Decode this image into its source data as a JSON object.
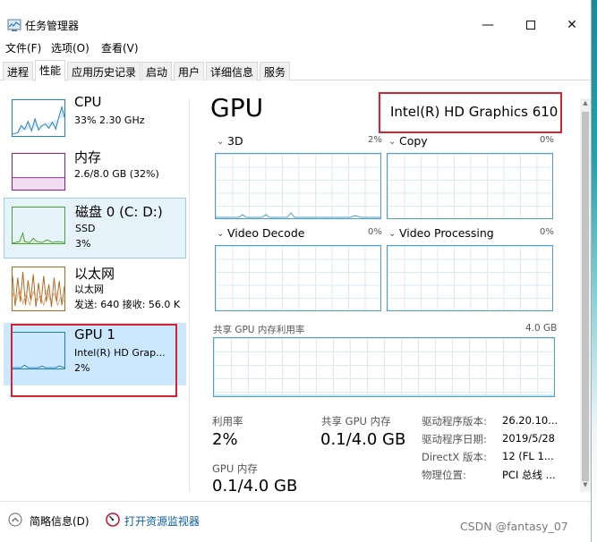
{
  "window": {
    "title": "任务管理器"
  },
  "menu": [
    "文件(F)",
    "选项(O)",
    "查看(V)"
  ],
  "tabs": [
    "进程",
    "性能",
    "应用历史记录",
    "启动",
    "用户",
    "详细信息",
    "服务"
  ],
  "resources": {
    "cpu": {
      "name": "CPU",
      "sub1": "33% 2.30 GHz",
      "color": "#1d7ec7"
    },
    "memory": {
      "name": "内存",
      "sub1": "2.6/8.0 GB (32%)",
      "color": "#8b1a8b"
    },
    "disk": {
      "name": "磁盘 0 (C: D:)",
      "sub1": "SSD",
      "sub2": "3%",
      "color": "#4aa02c"
    },
    "ethernet": {
      "name": "以太网",
      "sub1": "以太网",
      "sub2": "发送: 640 接收: 56.0 K",
      "color": "#b5651d"
    },
    "gpu": {
      "name": "GPU 1",
      "sub1": "Intel(R) HD Grap...",
      "sub2": "2%",
      "color": "#1d7ec7"
    }
  },
  "gpu": {
    "title": "GPU",
    "model": "Intel(R) HD Graphics 610",
    "engines": [
      {
        "label": "3D",
        "pct": "2%"
      },
      {
        "label": "Copy",
        "pct": "0%"
      },
      {
        "label": "Video Decode",
        "pct": "0%"
      },
      {
        "label": "Video Processing",
        "pct": "0%"
      }
    ],
    "shared_label": "共享 GPU 内存利用率",
    "shared_max": "4.0 GB",
    "stats": {
      "util_label": "利用率",
      "util_value": "2%",
      "shared_mem_label": "共享 GPU 内存",
      "shared_mem_value": "0.1/4.0 GB",
      "gpu_mem_label": "GPU 内存",
      "gpu_mem_value": "0.1/4.0 GB"
    },
    "info": [
      {
        "label": "驱动程序版本:",
        "value": "26.20.10..."
      },
      {
        "label": "驱动程序日期:",
        "value": "2019/5/28"
      },
      {
        "label": "DirectX 版本:",
        "value": "12 (FL 1..."
      },
      {
        "label": "物理位置:",
        "value": "PCI 总线 ..."
      }
    ]
  },
  "footer": {
    "brief": "简略信息(D)",
    "monitor": "打开资源监视器",
    "watermark": "CSDN @fantasy_07"
  },
  "colors": {
    "highlight_red": "#d5242f",
    "graph_border": "#4aa0c9"
  }
}
